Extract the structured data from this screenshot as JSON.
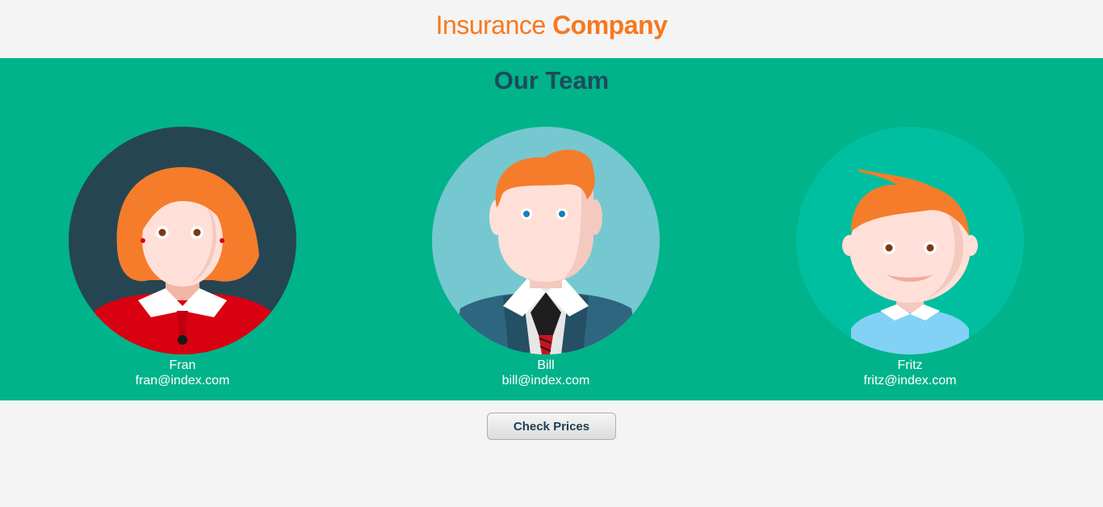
{
  "header": {
    "brand_light": "Insurance",
    "brand_bold": "Company"
  },
  "team": {
    "title": "Our Team",
    "members": [
      {
        "name": "Fran",
        "email": "fran@index.com",
        "avatar": "woman-avatar-icon"
      },
      {
        "name": "Bill",
        "email": "bill@index.com",
        "avatar": "man-avatar-icon"
      },
      {
        "name": "Fritz",
        "email": "fritz@index.com",
        "avatar": "boy-avatar-icon"
      }
    ]
  },
  "footer": {
    "button_label": "Check Prices"
  },
  "colors": {
    "brand": "#f7781e",
    "team_bg": "#00b38a",
    "title": "#1c4b5a",
    "page_bg": "#f4f4f4"
  }
}
